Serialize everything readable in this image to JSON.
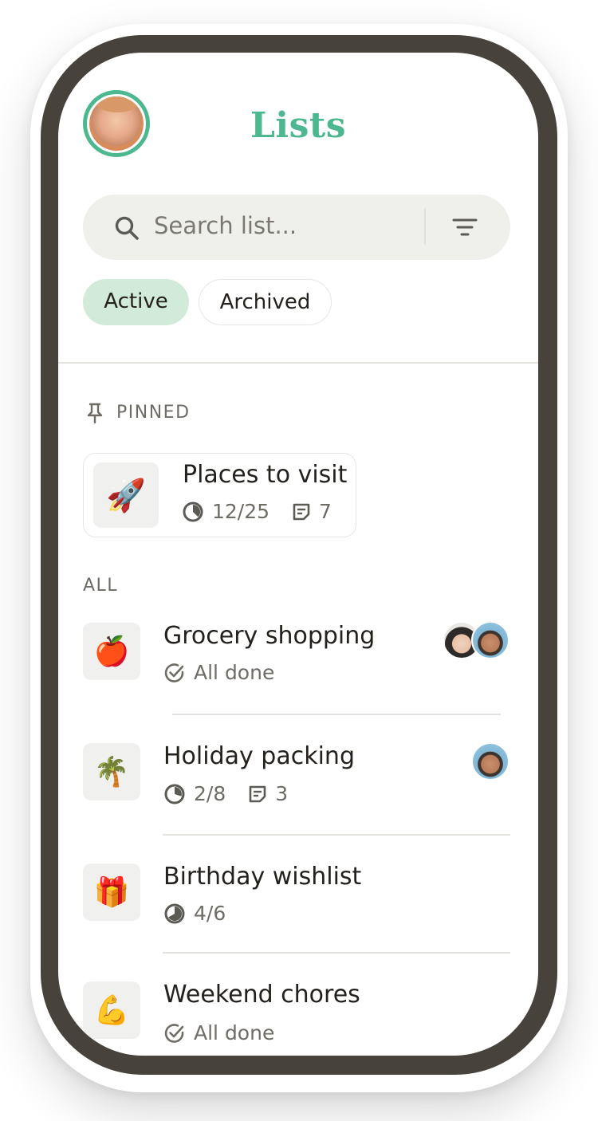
{
  "header": {
    "title": "Lists"
  },
  "search": {
    "placeholder": "Search list..."
  },
  "filters": {
    "active_label": "Active",
    "archived_label": "Archived"
  },
  "sections": {
    "pinned_label": "PINNED",
    "all_label": "ALL"
  },
  "pinned": {
    "title": "Places to visit",
    "emoji": "🚀",
    "progress": "12/25",
    "notes": "7"
  },
  "items": [
    {
      "title": "Grocery shopping",
      "emoji": "🍎",
      "status": "All done",
      "collaborators": [
        "woman",
        "man"
      ]
    },
    {
      "title": "Holiday packing",
      "emoji": "🌴",
      "progress": "2/8",
      "notes": "3",
      "collaborators": [
        "man"
      ]
    },
    {
      "title": "Birthday wishlist",
      "emoji": "🎁",
      "progress": "4/6"
    },
    {
      "title": "Weekend chores",
      "emoji": "💪",
      "status": "All done"
    }
  ],
  "colors": {
    "accent": "#4db88f",
    "active_chip": "#d2ead9",
    "frame": "#47423c",
    "search_bg": "#eff0ec"
  },
  "icons": [
    "search-icon",
    "filter-icon",
    "pin-icon",
    "progress-icon",
    "notes-icon",
    "check-circle-icon"
  ]
}
